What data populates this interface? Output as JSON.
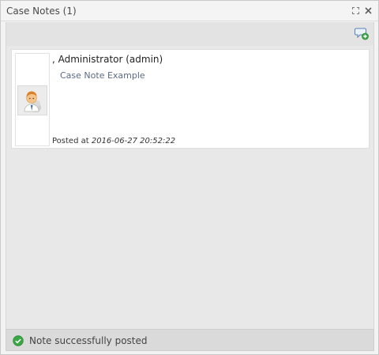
{
  "window": {
    "title": "Case Notes (1)"
  },
  "icons": {
    "maximize": "maximize-icon",
    "close": "close-icon",
    "add_note": "add-note-icon",
    "avatar": "user-avatar-icon",
    "status": "success-check-icon"
  },
  "notes": [
    {
      "author": ", Administrator (admin)",
      "body": "Case Note Example",
      "posted_prefix": "Posted at",
      "posted_time": "2016-06-27 20:52:22"
    }
  ],
  "status": {
    "message": "Note successfully posted",
    "color": "#3aa745"
  },
  "colors": {
    "panel_bg": "#e8e8e8",
    "note_bg": "#ffffff",
    "statusbar_bg": "#dadada"
  }
}
